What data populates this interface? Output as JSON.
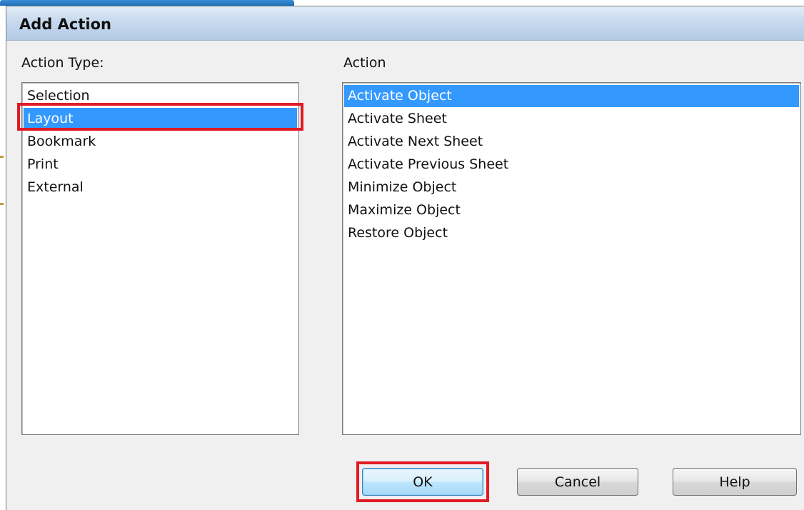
{
  "dialog": {
    "title": "Add Action"
  },
  "action_type": {
    "label": "Action Type:",
    "items": [
      {
        "label": "Selection",
        "selected": false
      },
      {
        "label": "Layout",
        "selected": true
      },
      {
        "label": "Bookmark",
        "selected": false
      },
      {
        "label": "Print",
        "selected": false
      },
      {
        "label": "External",
        "selected": false
      }
    ]
  },
  "action": {
    "label": "Action",
    "items": [
      {
        "label": "Activate Object",
        "selected": true
      },
      {
        "label": "Activate Sheet",
        "selected": false
      },
      {
        "label": "Activate Next Sheet",
        "selected": false
      },
      {
        "label": "Activate Previous Sheet",
        "selected": false
      },
      {
        "label": "Minimize Object",
        "selected": false
      },
      {
        "label": "Maximize Object",
        "selected": false
      },
      {
        "label": "Restore Object",
        "selected": false
      }
    ]
  },
  "buttons": {
    "ok": "OK",
    "cancel": "Cancel",
    "help": "Help"
  },
  "colors": {
    "selection": "#3399ff",
    "highlight_box": "#e01b24",
    "title_bar": "#c7d9ee"
  }
}
